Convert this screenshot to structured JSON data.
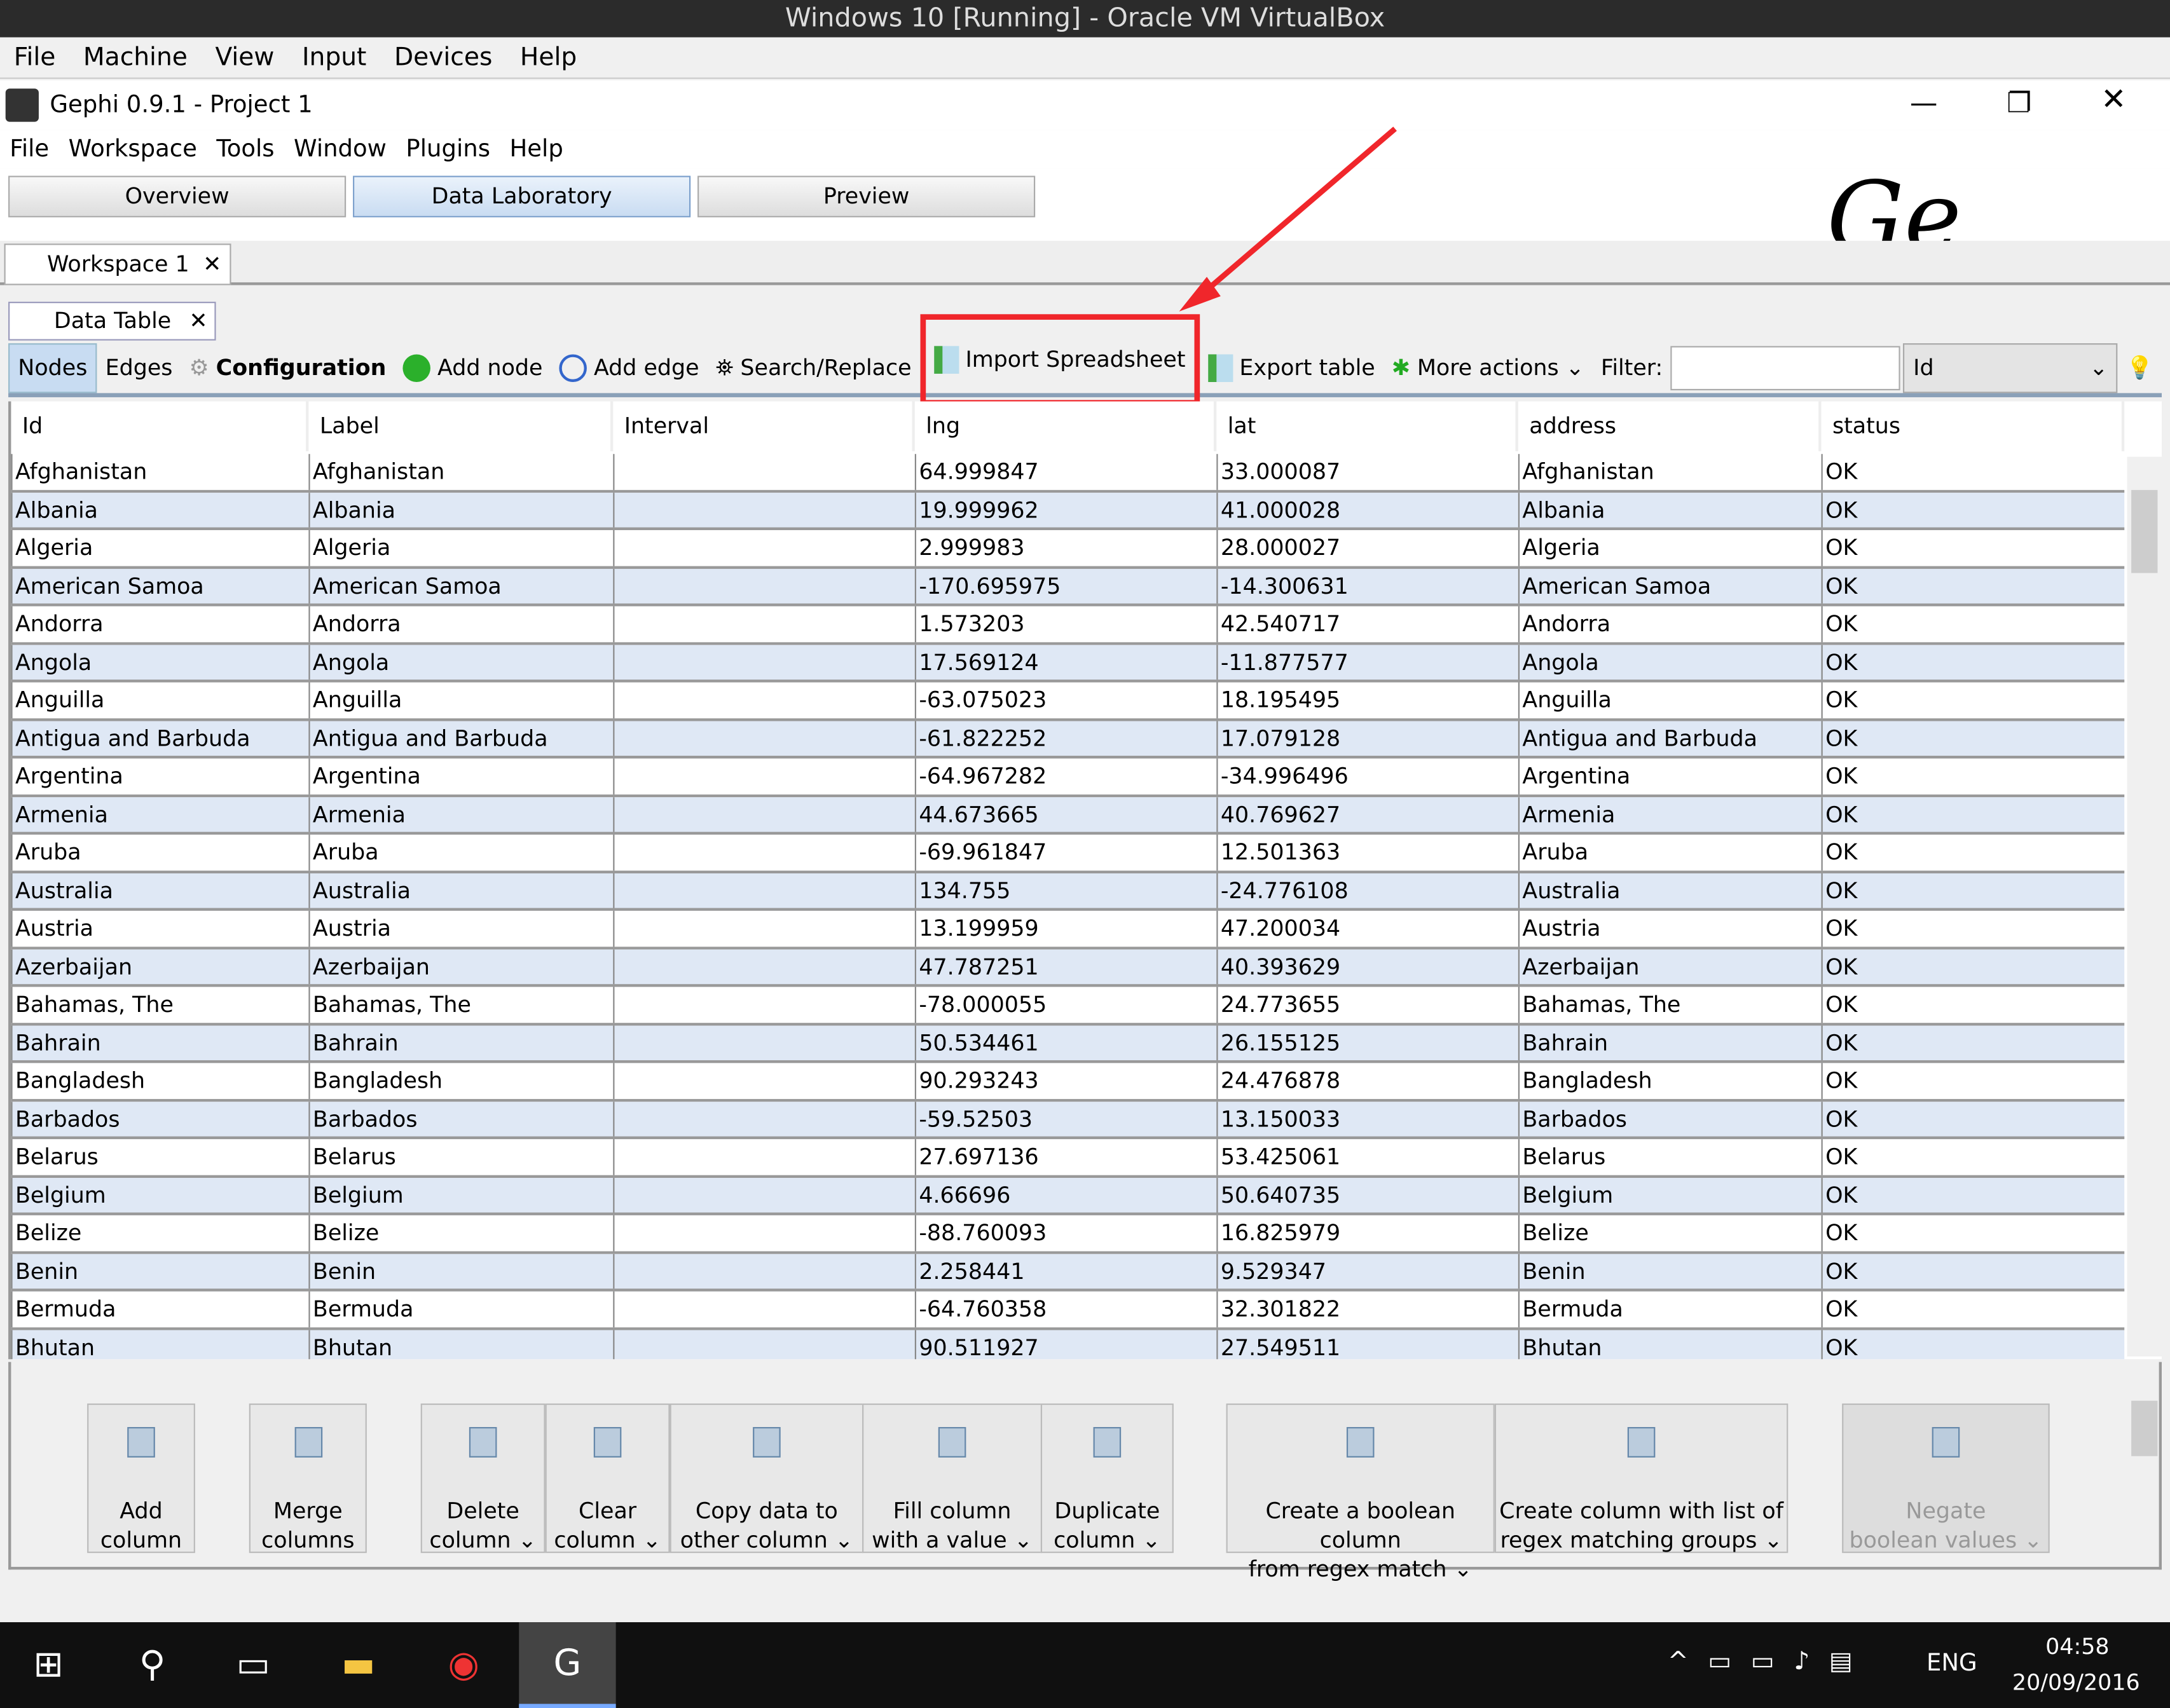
{
  "vbox": {
    "title": "Windows 10 [Running] - Oracle VM VirtualBox",
    "menu": [
      "File",
      "Machine",
      "View",
      "Input",
      "Devices",
      "Help"
    ]
  },
  "gephi": {
    "title": "Gephi 0.9.1 - Project 1",
    "menu": [
      "File",
      "Workspace",
      "Tools",
      "Window",
      "Plugins",
      "Help"
    ],
    "modes": [
      "Overview",
      "Data Laboratory",
      "Preview"
    ],
    "active_mode": "Data Laboratory"
  },
  "workspace_tab": "Workspace 1",
  "panel_tab": "Data Table",
  "toolbar": {
    "nodes": "Nodes",
    "edges": "Edges",
    "configuration": "Configuration",
    "add_node": "Add node",
    "add_edge": "Add edge",
    "search_replace": "Search/Replace",
    "import_spreadsheet": "Import Spreadsheet",
    "export_table": "Export table",
    "more_actions": "More actions",
    "filter_label": "Filter:",
    "filter_value": "",
    "filter_column": "Id"
  },
  "highlight_color": "#f0262b",
  "table": {
    "columns": [
      "Id",
      "Label",
      "Interval",
      "lng",
      "lat",
      "address",
      "status"
    ],
    "rows": [
      [
        "Afghanistan",
        "Afghanistan",
        "",
        "64.999847",
        "33.000087",
        "Afghanistan",
        "OK"
      ],
      [
        "Albania",
        "Albania",
        "",
        "19.999962",
        "41.000028",
        "Albania",
        "OK"
      ],
      [
        "Algeria",
        "Algeria",
        "",
        "2.999983",
        "28.000027",
        "Algeria",
        "OK"
      ],
      [
        "American Samoa",
        "American Samoa",
        "",
        "-170.695975",
        "-14.300631",
        "American Samoa",
        "OK"
      ],
      [
        "Andorra",
        "Andorra",
        "",
        "1.573203",
        "42.540717",
        "Andorra",
        "OK"
      ],
      [
        "Angola",
        "Angola",
        "",
        "17.569124",
        "-11.877577",
        "Angola",
        "OK"
      ],
      [
        "Anguilla",
        "Anguilla",
        "",
        "-63.075023",
        "18.195495",
        "Anguilla",
        "OK"
      ],
      [
        "Antigua and Barbuda",
        "Antigua and Barbuda",
        "",
        "-61.822252",
        "17.079128",
        "Antigua and Barbuda",
        "OK"
      ],
      [
        "Argentina",
        "Argentina",
        "",
        "-64.967282",
        "-34.996496",
        "Argentina",
        "OK"
      ],
      [
        "Armenia",
        "Armenia",
        "",
        "44.673665",
        "40.769627",
        "Armenia",
        "OK"
      ],
      [
        "Aruba",
        "Aruba",
        "",
        "-69.961847",
        "12.501363",
        "Aruba",
        "OK"
      ],
      [
        "Australia",
        "Australia",
        "",
        "134.755",
        "-24.776108",
        "Australia",
        "OK"
      ],
      [
        "Austria",
        "Austria",
        "",
        "13.199959",
        "47.200034",
        "Austria",
        "OK"
      ],
      [
        "Azerbaijan",
        "Azerbaijan",
        "",
        "47.787251",
        "40.393629",
        "Azerbaijan",
        "OK"
      ],
      [
        "Bahamas, The",
        "Bahamas, The",
        "",
        "-78.000055",
        "24.773655",
        "Bahamas, The",
        "OK"
      ],
      [
        "Bahrain",
        "Bahrain",
        "",
        "50.534461",
        "26.155125",
        "Bahrain",
        "OK"
      ],
      [
        "Bangladesh",
        "Bangladesh",
        "",
        "90.293243",
        "24.476878",
        "Bangladesh",
        "OK"
      ],
      [
        "Barbados",
        "Barbados",
        "",
        "-59.52503",
        "13.150033",
        "Barbados",
        "OK"
      ],
      [
        "Belarus",
        "Belarus",
        "",
        "27.697136",
        "53.425061",
        "Belarus",
        "OK"
      ],
      [
        "Belgium",
        "Belgium",
        "",
        "4.66696",
        "50.640735",
        "Belgium",
        "OK"
      ],
      [
        "Belize",
        "Belize",
        "",
        "-88.760093",
        "16.825979",
        "Belize",
        "OK"
      ],
      [
        "Benin",
        "Benin",
        "",
        "2.258441",
        "9.529347",
        "Benin",
        "OK"
      ],
      [
        "Bermuda",
        "Bermuda",
        "",
        "-64.760358",
        "32.301822",
        "Bermuda",
        "OK"
      ],
      [
        "Bhutan",
        "Bhutan",
        "",
        "90.511927",
        "27.549511",
        "Bhutan",
        "OK"
      ]
    ]
  },
  "column_actions": [
    {
      "l1": "Add",
      "l2": "column"
    },
    {
      "l1": "Merge",
      "l2": "columns"
    },
    {
      "l1": "Delete",
      "l2": "column ⌄"
    },
    {
      "l1": "Clear",
      "l2": "column ⌄"
    },
    {
      "l1": "Copy data to",
      "l2": "other column ⌄"
    },
    {
      "l1": "Fill column",
      "l2": "with a value ⌄"
    },
    {
      "l1": "Duplicate",
      "l2": "column ⌄"
    },
    {
      "l1": "Create a boolean column",
      "l2": "from regex match ⌄"
    },
    {
      "l1": "Create column with list of",
      "l2": "regex matching groups ⌄"
    },
    {
      "l1": "Negate",
      "l2": "boolean values ⌄",
      "disabled": true
    }
  ],
  "taskbar": {
    "lang": "ENG",
    "time": "04:58",
    "date": "20/09/2016"
  }
}
